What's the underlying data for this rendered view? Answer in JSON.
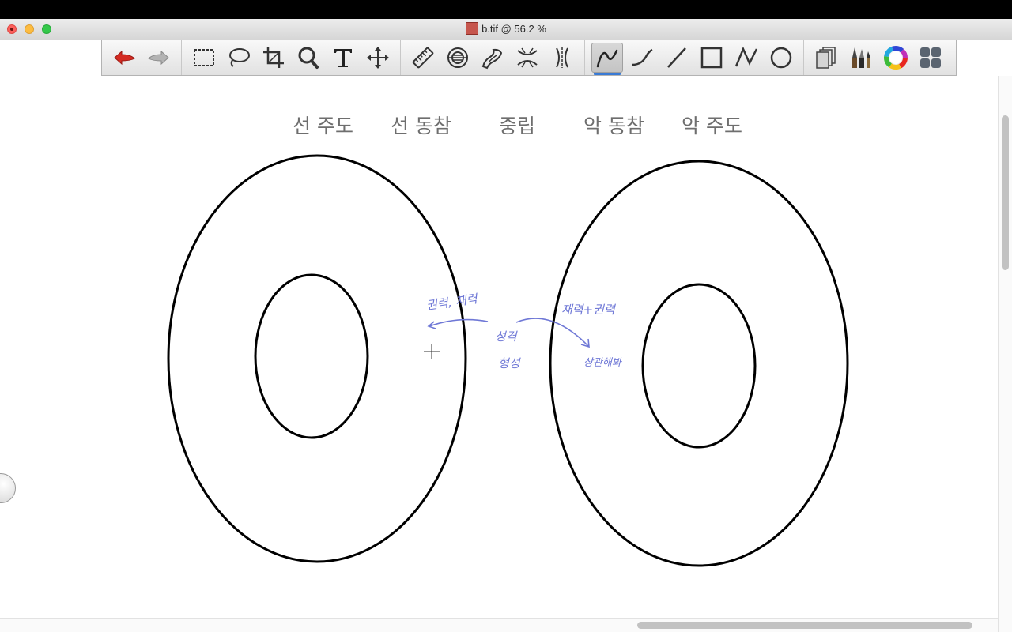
{
  "window": {
    "title": "b.tif @ 56.2 %"
  },
  "toolbar": {
    "groups": [
      [
        "undo-icon",
        "redo-icon"
      ],
      [
        "rectangular-select-icon",
        "lasso-select-icon",
        "crop-icon",
        "zoom-icon",
        "text-icon",
        "move-icon"
      ],
      [
        "ruler-icon",
        "lens-icon",
        "smudge-icon",
        "liquify-icon",
        "distort-icon"
      ],
      [
        "freehand-line-icon",
        "curve-icon",
        "line-icon",
        "rectangle-icon",
        "polyline-icon",
        "ellipse-icon"
      ],
      [
        "layers-icon",
        "brushes-icon",
        "color-wheel-icon",
        "palettes-icon"
      ]
    ],
    "active_tool": "freehand-line-icon",
    "colors": {
      "undo": "#d42b22",
      "redo": "#a9a9a9",
      "accent": "#3a7bd5"
    }
  },
  "canvas": {
    "alignment_labels": [
      "선 주도",
      "선 동참",
      "중립",
      "악 동참",
      "악 주도"
    ],
    "annotations": {
      "left_note": "권력, 재력",
      "center_top": "성격",
      "center_bottom": "형성",
      "right_note": "재력+권력",
      "right_bottom": "상관해봐"
    },
    "ink_color": "#6f78d6"
  }
}
